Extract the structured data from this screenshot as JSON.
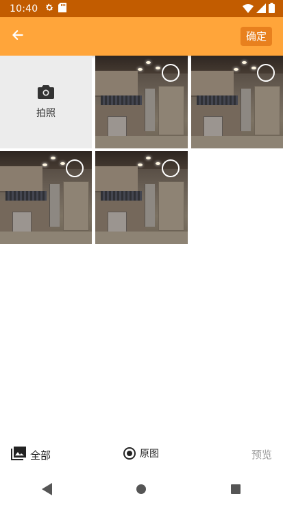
{
  "status_bar": {
    "time": "10:40",
    "icons": [
      "settings-icon",
      "sd-card-icon",
      "wifi-icon",
      "signal-icon",
      "battery-icon"
    ]
  },
  "app_bar": {
    "confirm_label": "确定",
    "back_icon": "back-arrow-icon",
    "background": "#ffa53a",
    "confirm_background": "#e8801e"
  },
  "grid": {
    "camera": {
      "label": "拍照",
      "icon": "camera-icon"
    },
    "photos_count": 4
  },
  "bottom_bar": {
    "folder_label": "全部",
    "original_label": "原图",
    "preview_label": "预览"
  },
  "nav_bar": {
    "buttons": [
      "back-triangle-icon",
      "home-circle-icon",
      "recents-square-icon"
    ]
  }
}
